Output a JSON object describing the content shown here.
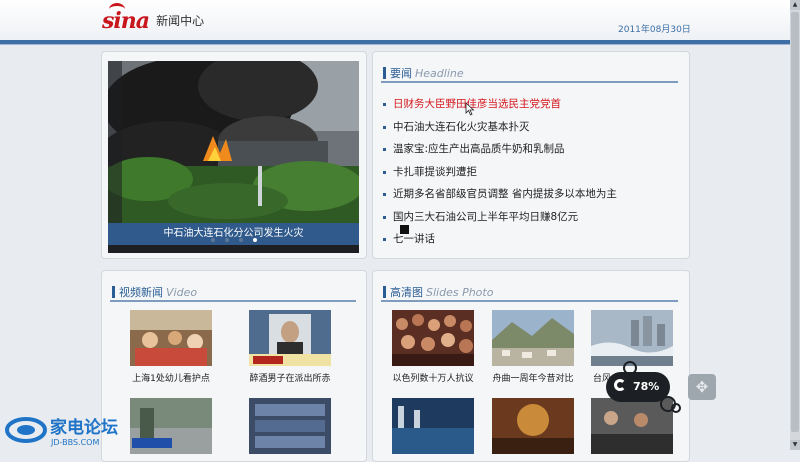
{
  "header": {
    "logo_text": "sina",
    "logo_sub": "新闻中心",
    "date": "2011年08月30日"
  },
  "slideshow": {
    "caption": "中石油大连石化分公司发生火灾",
    "dot_count": 4,
    "active_dot": 3
  },
  "headline_section": {
    "title": "要闻",
    "title_en": "Headline",
    "items": [
      "日财务大臣野田佳彦当选民主党党首",
      "中石油大连石化火灾基本扑灭",
      "温家宝:应生产出高品质牛奶和乳制品",
      "卡扎菲提谈判遭拒",
      "近期多名省部级官员调整 省内提拔多以本地为主",
      "国内三大石油公司上半年平均日赚8亿元",
      "七一讲话"
    ]
  },
  "video_section": {
    "title": "视频新闻",
    "title_en": "Video",
    "items": [
      {
        "caption": "上海1处幼儿看护点"
      },
      {
        "caption": "醉酒男子在派出所赤"
      },
      {
        "caption": ""
      },
      {
        "caption": ""
      }
    ]
  },
  "photo_section": {
    "title": "高清图",
    "title_en": "Slides Photo",
    "items": [
      {
        "caption": "以色列数十万人抗议"
      },
      {
        "caption": "舟曲一周年今昔对比"
      },
      {
        "caption": "台风"
      },
      {
        "caption": ""
      },
      {
        "caption": ""
      },
      {
        "caption": ""
      }
    ]
  },
  "overlay": {
    "progress_label": "78%",
    "progress": 0.78
  },
  "watermark": {
    "name": "家电论坛",
    "url": "JD-BBS.COM"
  },
  "colors": {
    "brand_red": "#c8161d",
    "accent_blue": "#2a5d94",
    "headline_red": "#d4171b"
  }
}
